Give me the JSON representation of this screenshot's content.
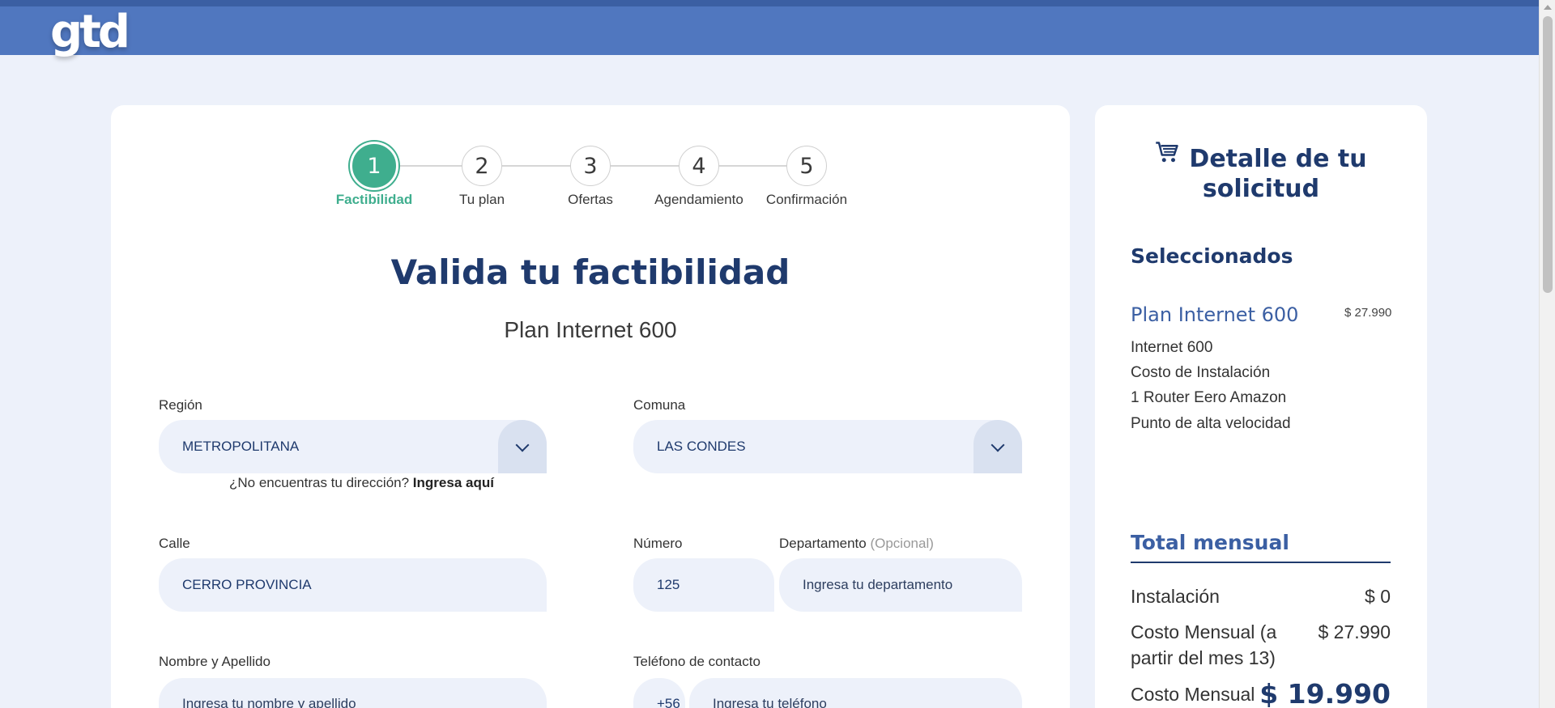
{
  "header": {
    "logo_text": "gtd"
  },
  "stepper": {
    "steps": [
      {
        "number": "1",
        "label": "Factibilidad",
        "active": true
      },
      {
        "number": "2",
        "label": "Tu plan"
      },
      {
        "number": "3",
        "label": "Ofertas"
      },
      {
        "number": "4",
        "label": "Agendamiento"
      },
      {
        "number": "5",
        "label": "Confirmación"
      }
    ]
  },
  "form": {
    "title": "Valida tu factibilidad",
    "subtitle": "Plan Internet 600",
    "region": {
      "label": "Región",
      "value": "METROPOLITANA"
    },
    "comuna": {
      "label": "Comuna",
      "value": "LAS CONDES"
    },
    "helper": {
      "text": "¿No encuentras tu dirección?",
      "link": "Ingresa aquí"
    },
    "calle": {
      "label": "Calle",
      "value": "CERRO PROVINCIA"
    },
    "numero": {
      "label": "Número",
      "value": "125"
    },
    "departamento": {
      "label": "Departamento",
      "optional": "(Opcional)",
      "placeholder": "Ingresa tu departamento"
    },
    "nombre": {
      "label": "Nombre y Apellido",
      "placeholder": "Ingresa tu nombre y apellido"
    },
    "telefono": {
      "label": "Teléfono de contacto",
      "prefix": "+56",
      "placeholder": "Ingresa tu teléfono"
    }
  },
  "summary": {
    "title": "Detalle de tu solicitud",
    "cart_icon": "cart-icon",
    "selected_heading": "Seleccionados",
    "plan_name": "Plan Internet 600",
    "plan_price": "$ 27.990",
    "items": [
      "Internet 600",
      "Costo de Instalación",
      "1 Router Eero Amazon",
      "Punto de alta velocidad"
    ],
    "total_heading": "Total mensual",
    "installation_label": "Instalación",
    "installation_value": "$ 0",
    "monthly_after_label": "Costo Mensual (a partir del mes 13)",
    "monthly_after_value": "$ 27.990",
    "monthly_label": "Costo Mensual",
    "monthly_value": "$ 19.990"
  },
  "colors": {
    "brand_blue": "#5077bf",
    "navy": "#1f3a6d",
    "step_active": "#3fae8e"
  }
}
